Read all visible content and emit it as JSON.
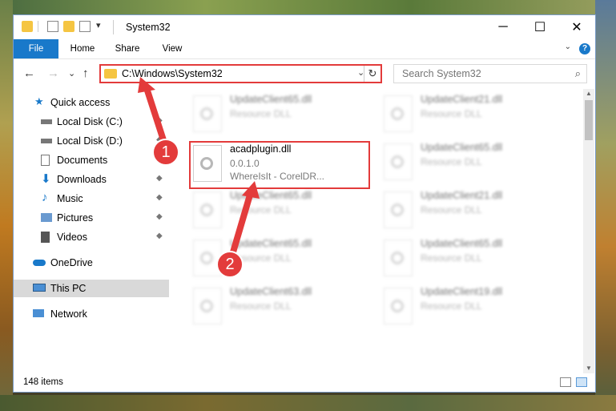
{
  "titlebar": {
    "title": "System32",
    "minimize_glyph": "─",
    "maximize_glyph": "☐",
    "close_glyph": "✕",
    "qat_dropdown_glyph": "▾"
  },
  "ribbon": {
    "tabs": [
      "File",
      "Home",
      "Share",
      "View"
    ],
    "help_glyph": "?",
    "expand_glyph": "⌄"
  },
  "navbar": {
    "back_glyph": "←",
    "forward_glyph": "→",
    "recent_glyph": "⌄",
    "up_glyph": "↑",
    "address": "C:\\Windows\\System32",
    "address_dropdown_glyph": "⌄",
    "refresh_glyph": "↻",
    "search_placeholder": "Search System32",
    "search_glyph": "⌕"
  },
  "sidebar": {
    "items": [
      {
        "label": "Quick access",
        "icon": "star-icon",
        "pinned": false
      },
      {
        "label": "Local Disk (C:)",
        "icon": "drive-icon",
        "pinned": true
      },
      {
        "label": "Local Disk (D:)",
        "icon": "drive-icon",
        "pinned": true
      },
      {
        "label": "Documents",
        "icon": "documents-icon",
        "pinned": true
      },
      {
        "label": "Downloads",
        "icon": "download-arrow-icon",
        "pinned": true
      },
      {
        "label": "Music",
        "icon": "music-note-icon",
        "pinned": true
      },
      {
        "label": "Pictures",
        "icon": "pictures-icon",
        "pinned": true
      },
      {
        "label": "Videos",
        "icon": "film-icon",
        "pinned": true
      },
      {
        "label": "OneDrive",
        "icon": "cloud-icon",
        "pinned": false
      },
      {
        "label": "This PC",
        "icon": "computer-icon",
        "pinned": false,
        "selected": true
      },
      {
        "label": "Network",
        "icon": "network-icon",
        "pinned": false
      }
    ],
    "pin_glyph": "📌"
  },
  "files": {
    "highlighted": {
      "name": "acadplugin.dll",
      "version": "0.0.1.0",
      "description": "WhereIsIt - CorelDR..."
    },
    "blurred": [
      {
        "name": "UpdateClient65.dll",
        "type": "Resource DLL"
      },
      {
        "name": "UpdateClient21.dll",
        "type": "Resource DLL"
      },
      {
        "name": "UpdateClient65.dll",
        "type": "Resource DLL"
      },
      {
        "name": "UpdateClient65.dll",
        "type": "Resource DLL"
      },
      {
        "name": "UpdateClient21.dll",
        "type": "Resource DLL"
      },
      {
        "name": "UpdateClient65.dll",
        "type": "Resource DLL"
      },
      {
        "name": "UpdateClient65.dll",
        "type": "Resource DLL"
      },
      {
        "name": "UpdateClient63.dll",
        "type": "Resource DLL"
      },
      {
        "name": "UpdateClient19.dll",
        "type": "Resource DLL"
      }
    ]
  },
  "statusbar": {
    "item_count": "148 items"
  },
  "annotations": {
    "step1": "1",
    "step2": "2",
    "color": "#e33b3b"
  }
}
